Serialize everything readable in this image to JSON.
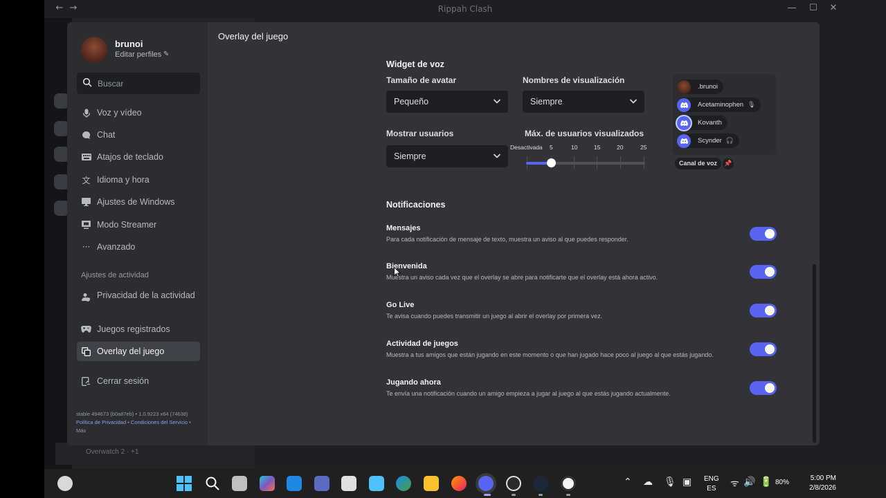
{
  "window": {
    "title": "Rippah Clash"
  },
  "background": {
    "bottom_status": "Overwatch 2 · +1"
  },
  "sidebar": {
    "user": {
      "name": "brunoi",
      "edit_label": "Editar perfiles"
    },
    "search": {
      "placeholder": "Buscar"
    },
    "items": [
      {
        "label": "Voz y vídeo",
        "icon": "microphone-icon"
      },
      {
        "label": "Chat",
        "icon": "chat-bubble-icon"
      },
      {
        "label": "Atajos de teclado",
        "icon": "keyboard-icon"
      },
      {
        "label": "Idioma y hora",
        "icon": "translate-icon"
      },
      {
        "label": "Ajustes de Windows",
        "icon": "monitor-icon"
      },
      {
        "label": "Modo Streamer",
        "icon": "stream-icon"
      },
      {
        "label": "Avanzado",
        "icon": "ellipsis-icon"
      }
    ],
    "activity_header": "Ajustes de actividad",
    "activity_items": [
      {
        "label": "Privacidad de la actividad",
        "icon": "person-shield-icon"
      },
      {
        "label": "Juegos registrados",
        "icon": "gamepad-icon"
      },
      {
        "label": "Overlay del juego",
        "icon": "overlay-icon",
        "active": true
      }
    ],
    "logout": {
      "label": "Cerrar sesión",
      "icon": "logout-icon"
    },
    "version": {
      "build": "stable 494673 (b0a87eb) • 1.0.9223 x64 (74638)",
      "privacy": "Política de Privacidad",
      "terms": "Condiciones del Servicio",
      "more": "Más"
    }
  },
  "main": {
    "title": "Overlay del juego",
    "voice_widget": {
      "title": "Widget de voz",
      "avatar_size": {
        "label": "Tamaño de avatar",
        "value": "Pequeño"
      },
      "display_names": {
        "label": "Nombres de visualización",
        "value": "Siempre"
      },
      "show_users": {
        "label": "Mostrar usuarios",
        "value": "Siempre"
      },
      "max_users": {
        "label": "Máx. de usuarios visualizados",
        "ticks": [
          "Desactivada",
          "5",
          "10",
          "15",
          "20",
          "25"
        ],
        "value": 5
      },
      "preview": {
        "users": [
          {
            "name": ".brunoi",
            "type": "self"
          },
          {
            "name": "Acetaminophen",
            "type": "discord",
            "status": "muted"
          },
          {
            "name": "Kovanth",
            "type": "discord"
          },
          {
            "name": "Scynder",
            "type": "discord",
            "status": "deafened"
          }
        ],
        "channel_label": "Canal de voz"
      }
    },
    "notifications": {
      "title": "Notificaciones",
      "items": [
        {
          "title": "Mensajes",
          "desc": "Para cada notificación de mensaje de texto, muestra un aviso al que puedes responder.",
          "enabled": true
        },
        {
          "title": "Bienvenida",
          "desc": "Muestra un aviso cada vez que el overlay se abre para notificarte que el overlay está ahora activo.",
          "enabled": true
        },
        {
          "title": "Go Live",
          "desc": "Te avisa cuando puedes transmitir un juego al abrir el overlay por primera vez.",
          "enabled": true
        },
        {
          "title": "Actividad de juegos",
          "desc": "Muestra a tus amigos que están jugando en este momento o que han jugado hace poco al juego al que estás jugando.",
          "enabled": true
        },
        {
          "title": "Jugando ahora",
          "desc": "Te envía una notificación cuando un amigo empieza a jugar al juego al que estás jugando actualmente.",
          "enabled": true
        }
      ]
    }
  },
  "taskbar": {
    "lang": "ENG",
    "region": "ES",
    "battery": "80%",
    "time": "5:00 PM",
    "date": "2/8/2026"
  },
  "colors": {
    "accent": "#5865f2",
    "modal_bg": "#313338",
    "sidebar_bg": "#2b2d31",
    "input_bg": "#1e1f22"
  }
}
